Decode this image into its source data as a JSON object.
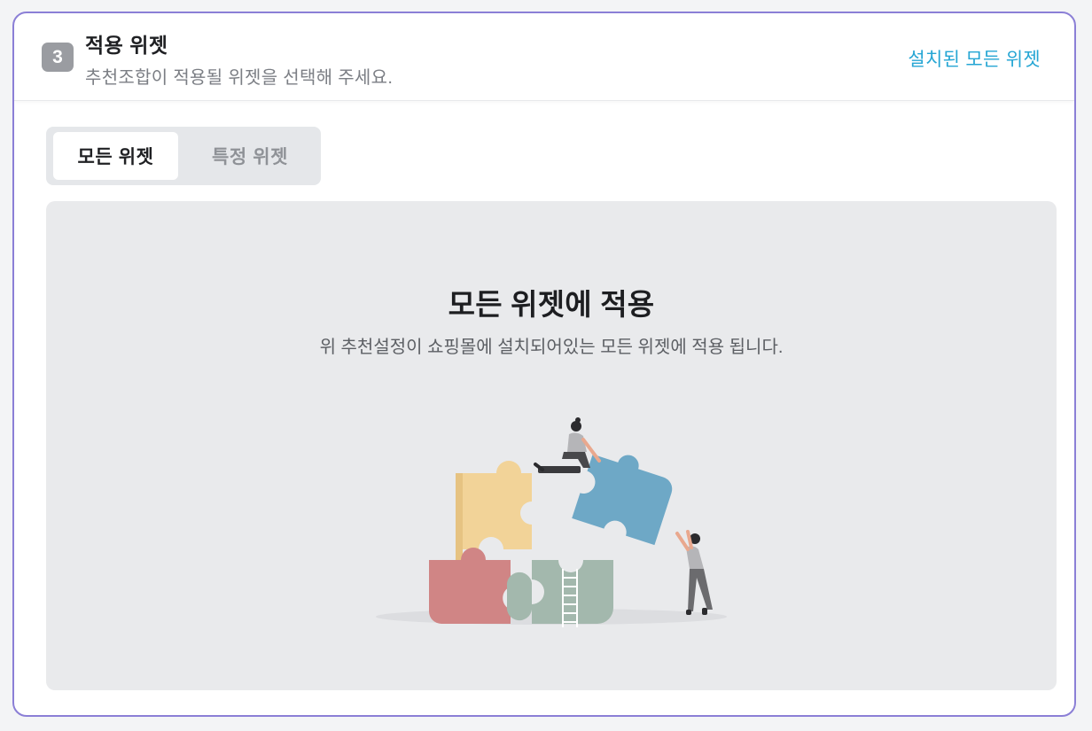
{
  "section": {
    "step_number": "3",
    "title": "적용 위젯",
    "subtitle": "추천조합이 적용될 위젯을 선택해 주세요.",
    "link_label": "설치된 모든 위젯"
  },
  "tabs": [
    {
      "label": "모든 위젯",
      "selected": true
    },
    {
      "label": "특정 위젯",
      "selected": false
    }
  ],
  "panel": {
    "title": "모든 위젯에 적용",
    "description": "위 추천설정이 쇼핑몰에 설치되어있는 모든 위젯에 적용 됩니다."
  },
  "colors": {
    "accent_link": "#26a6d4",
    "border": "#8b7fd6",
    "puzzle_yellow": "#f2d398",
    "puzzle_blue": "#6ea8c6",
    "puzzle_red": "#d08585",
    "puzzle_green": "#9fb5aa"
  }
}
